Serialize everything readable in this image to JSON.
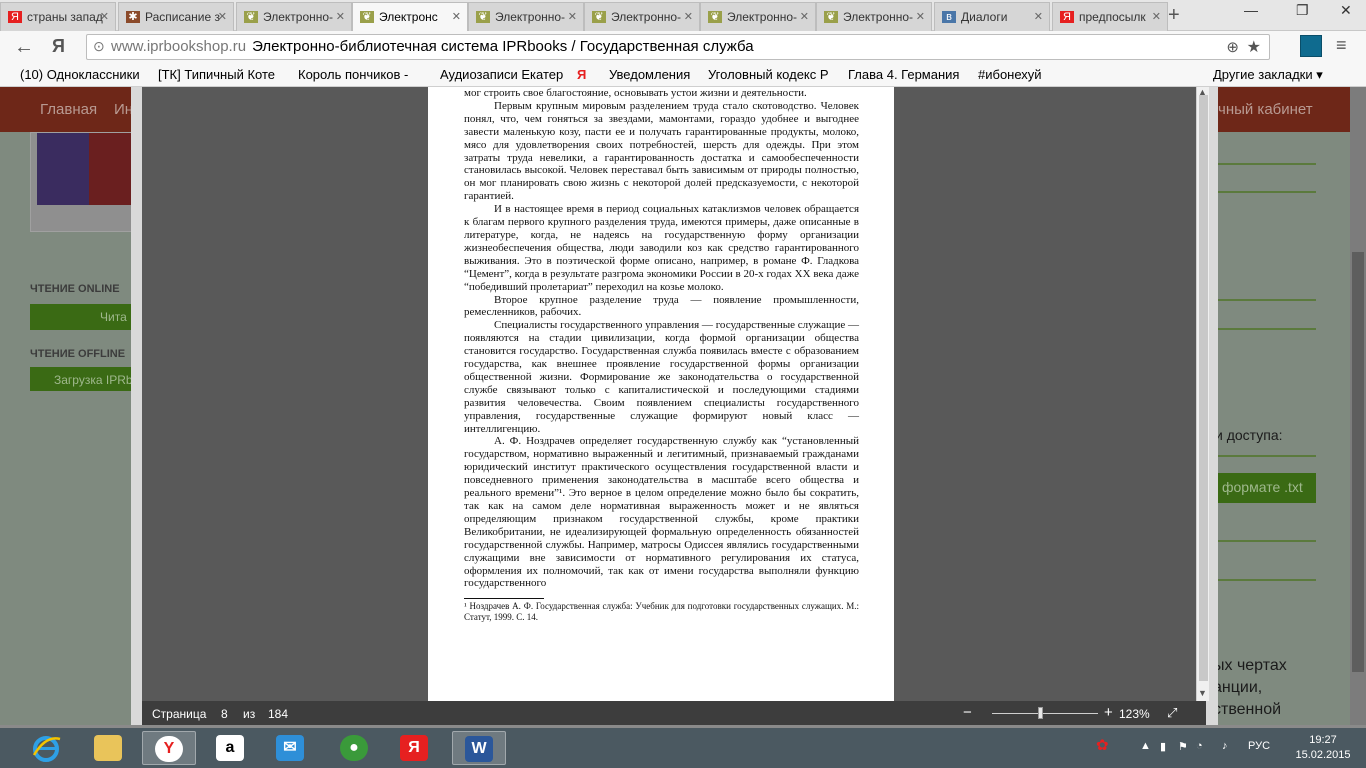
{
  "browser": {
    "tabs": [
      {
        "label": "страны запад",
        "favicon": "Я",
        "favcolor": "#e62020",
        "active": false
      },
      {
        "label": "Расписание з",
        "favicon": "✱",
        "favcolor": "#8b4a2a",
        "active": false
      },
      {
        "label": "Электронно-",
        "favicon": "❦",
        "favcolor": "#9aa04a",
        "active": false
      },
      {
        "label": "Электронс",
        "favicon": "❦",
        "favcolor": "#9aa04a",
        "active": true
      },
      {
        "label": "Электронно-",
        "favicon": "❦",
        "favcolor": "#9aa04a",
        "active": false
      },
      {
        "label": "Электронно-",
        "favicon": "❦",
        "favcolor": "#9aa04a",
        "active": false
      },
      {
        "label": "Электронно-",
        "favicon": "❦",
        "favcolor": "#9aa04a",
        "active": false
      },
      {
        "label": "Электронно-",
        "favicon": "❦",
        "favcolor": "#9aa04a",
        "active": false
      },
      {
        "label": "Диалоги",
        "favicon": "в",
        "favcolor": "#4a76a8",
        "active": false
      },
      {
        "label": "предпосылк",
        "favicon": "Я",
        "favcolor": "#e62020",
        "active": false
      }
    ],
    "address": {
      "domain": "www.iprbookshop.ru",
      "title": "Электронно-библиотечная система IPRbooks / Государственная служба"
    },
    "bookmarks": [
      "(10) Одноклассники",
      "[ТК] Типичный Коте",
      "Король пончиков -",
      "Аудиозаписи Екатер",
      "Уведомления",
      "Уголовный кодекс Р",
      "Глава 4. Германия",
      "#ибонехуй"
    ],
    "bookmarks_other": "Другие закладки"
  },
  "site": {
    "nav_home": "Главная",
    "nav_second": "Ин",
    "nav_cabinet": "чный кабинет",
    "online_label": "ЧТЕНИЕ ONLINE",
    "online_btn": "Чита",
    "offline_label": "ЧТЕНИЕ OFFLINE",
    "offline_btn": "Загрузка IPRb",
    "access_text": "и доступа:",
    "format_btn": "формате .txt",
    "right_lines": [
      "ых чертах",
      "анции,",
      "ственной"
    ]
  },
  "reader": {
    "paragraphs": [
      {
        "cont": true,
        "text": "мог строить свое благостояние, основывать устои жизни и деятельности."
      },
      {
        "cont": false,
        "text": "Первым крупным мировым разделением труда стало скотоводство. Человек понял, что, чем гоняться за звездами, мамонтами, гораздо удобнее и выгоднее завести маленькую козу, пасти ее и получать гарантированные продукты, молоко, мясо для удовлетворения своих потребностей, шерсть для одежды. При этом затраты труда невелики, а гарантированность достатка и самообеспеченности становилась высокой. Человек переставал быть зависимым от природы полностью, он мог планировать свою жизнь с некоторой долей предсказуемости, с некоторой гарантией."
      },
      {
        "cont": false,
        "text": "И в настоящее время в период социальных катаклизмов человек обращается к благам первого крупного разделения труда, имеются примеры, даже описанные в литературе, когда, не надеясь на государственную форму организации жизнеобеспечения общества, люди заводили коз как средство гарантированного выживания. Это в поэтической форме описано, например, в романе Ф. Гладкова “Цемент”, когда в результате разгрома экономики России в 20-х годах XX века даже “победивший пролетариат” переходил на козье молоко."
      },
      {
        "cont": false,
        "text": "Второе крупное разделение труда — появление промышленности, ремесленников, рабочих."
      },
      {
        "cont": false,
        "text": "Специалисты государственного управления — государственные служащие — появляются на стадии цивилизации, когда формой организации общества становится государство. Государственная служба появилась вместе с образованием государства, как внешнее проявление государственной формы организации общественной жизни. Формирование же законодательства о государственной службе связывают только с капиталистической и последующими стадиями развития человечества. Своим появлением специалисты государственного управления, государственные служащие формируют новый класс — интеллигенцию."
      },
      {
        "cont": false,
        "text": "А. Ф. Ноздрачев определяет государственную службу как “установленный государством, нормативно выраженный и легитимный, признаваемый гражданами юридический институт практического осуществления государственной власти и повседневного применения законодательства в масштабе всего общества и реального времени”¹. Это верное в целом определение можно было бы сократить, так как на самом деле нормативная выраженность может и не являться определяющим признаком государственной службы, кроме практики Великобритании, не идеализирующей формальную определенность обязанностей государственной службы. Например, матросы Одиссея являлись государственными служащими вне зависимости от нормативного регулирования их статуса, оформления их полномочий, так как от имени государства выполняли функцию государственного"
      }
    ],
    "footnote": "¹ Ноздрачев А. Ф. Государственная служба: Учебник для подготовки государственных служащих. М.: Статут, 1999. С. 14.",
    "status": {
      "page_label": "Страница",
      "page_num": "8",
      "of_label": "из",
      "total": "184",
      "zoom_minus": "−",
      "zoom_plus": "+",
      "zoom_value": "123%",
      "fit_icon": "⤢"
    }
  },
  "taskbar": {
    "tray_lang": "РУС",
    "time": "19:27",
    "date": "15.02.2015"
  }
}
